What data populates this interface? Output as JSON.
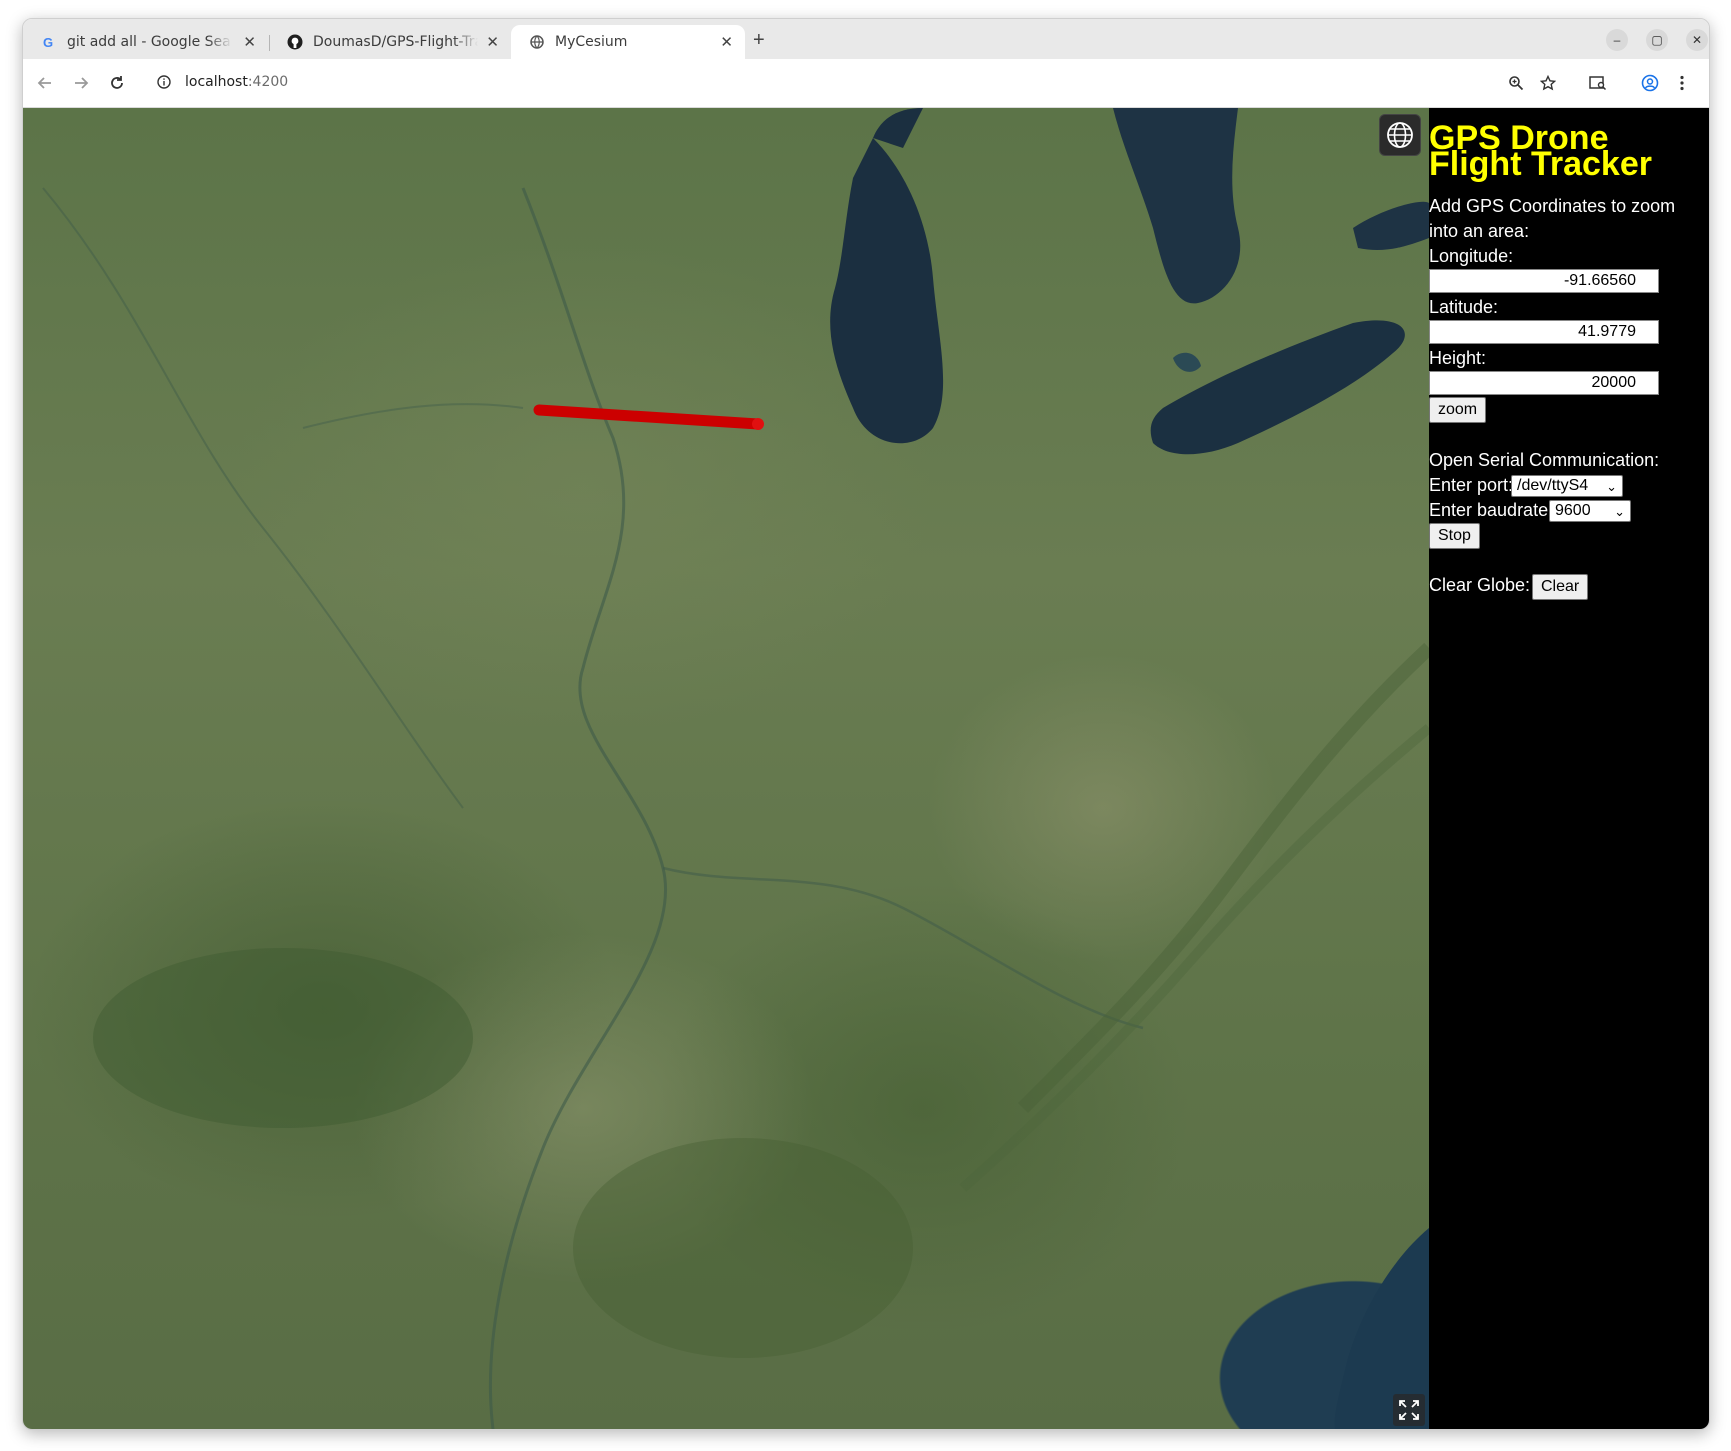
{
  "browser": {
    "tabs": [
      {
        "title": "git add all - Google Search",
        "icon": "google-icon"
      },
      {
        "title": "DoumasD/GPS-Flight-Tracker",
        "icon": "github-icon"
      },
      {
        "title": "MyCesium",
        "icon": "globe-icon",
        "active": true
      }
    ],
    "address": {
      "host": "localhost",
      "port": ":4200"
    }
  },
  "panel": {
    "title": "GPS Drone Flight Tracker",
    "intro": "Add GPS Coordinates to zoom into an area:",
    "longitude_label": "Longitude:",
    "longitude_value": "-91.66560",
    "latitude_label": "Latitude:",
    "latitude_value": "41.9779",
    "height_label": "Height:",
    "height_value": "20000",
    "zoom_label": "zoom",
    "serial_label": "Open Serial Communication:",
    "port_label": "Enter port:",
    "port_value": "/dev/ttyS4",
    "baud_label": "Enter baudrate:",
    "baud_value": "9600",
    "stop_label": "Stop",
    "clear_label_text": "Clear Globe:",
    "clear_button": "Clear"
  },
  "colors": {
    "accent_title": "#ffff00",
    "flight_path": "#cc0000",
    "panel_bg": "#000000"
  }
}
